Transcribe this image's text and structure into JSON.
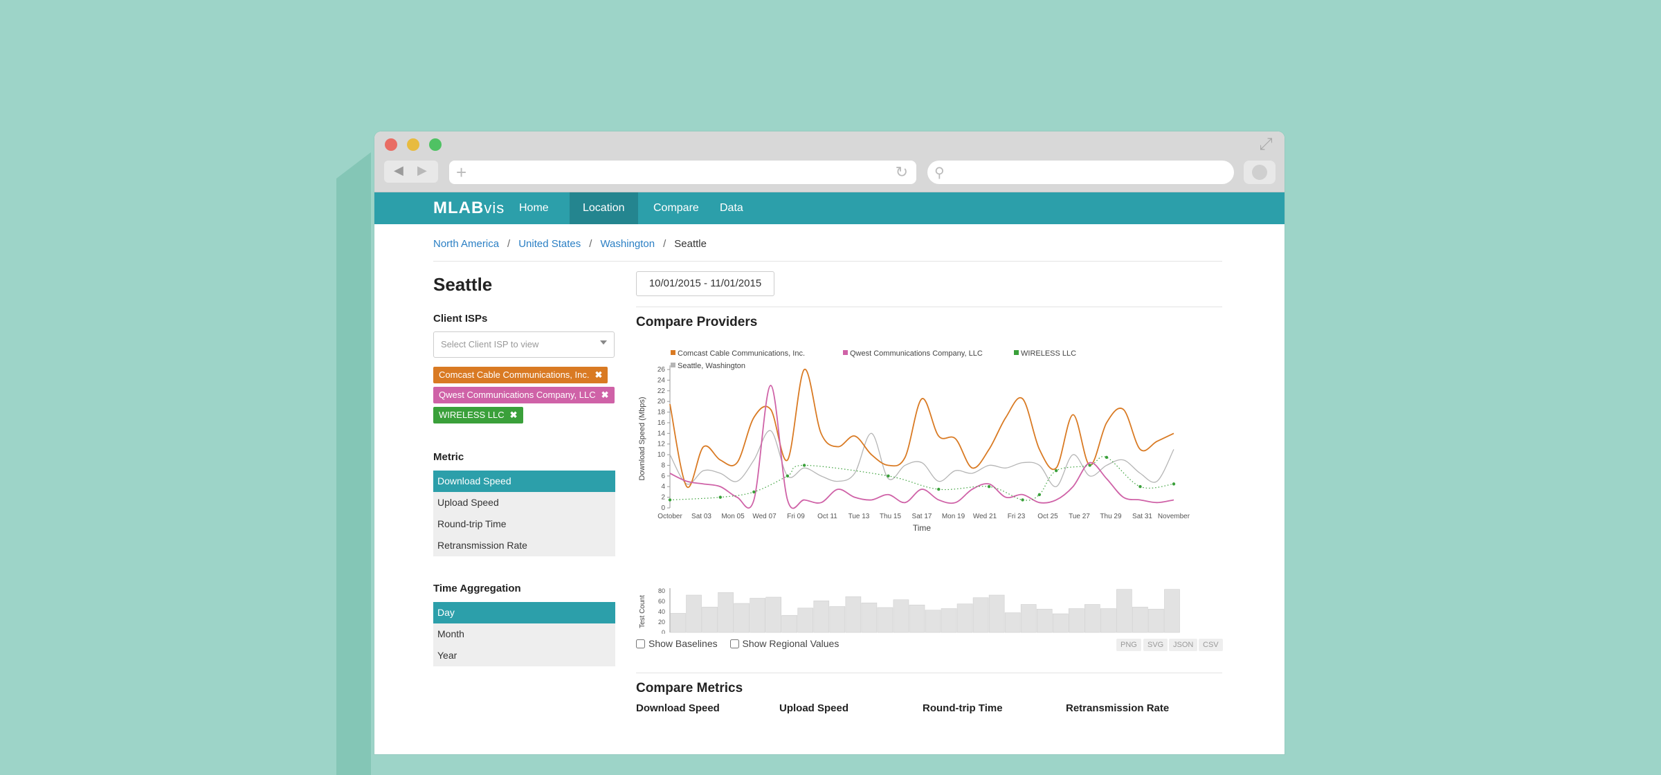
{
  "browser": {
    "url": "",
    "search": ""
  },
  "nav": {
    "logo_main": "MLAB",
    "logo_sub": "vis",
    "items": [
      {
        "label": "Home",
        "active": false
      },
      {
        "label": "Location",
        "active": true
      },
      {
        "label": "Compare",
        "active": false
      },
      {
        "label": "Data",
        "active": false
      }
    ]
  },
  "breadcrumb": [
    "North America",
    "United States",
    "Washington",
    "Seattle"
  ],
  "location": {
    "title": "Seattle",
    "isp_label": "Client ISPs",
    "isp_placeholder": "Select Client ISP to view",
    "isps": [
      {
        "label": "Comcast Cable Communications, Inc.",
        "color": "#d97a23"
      },
      {
        "label": "Qwest Communications Company, LLC",
        "color": "#cf62a7"
      },
      {
        "label": "WIRELESS LLC",
        "color": "#3aa03a"
      }
    ],
    "metric_label": "Metric",
    "metrics": [
      "Download Speed",
      "Upload Speed",
      "Round-trip Time",
      "Retransmission Rate"
    ],
    "metric_active": 0,
    "time_label": "Time Aggregation",
    "time_options": [
      "Day",
      "Month",
      "Year"
    ],
    "time_active": 0
  },
  "date_range": "10/01/2015 - 11/01/2015",
  "compare_title": "Compare Providers",
  "options": {
    "baselines": "Show Baselines",
    "regional": "Show Regional Values"
  },
  "export": [
    "PNG",
    "SVG",
    "JSON",
    "CSV"
  ],
  "metrics_section": {
    "title": "Compare Metrics",
    "columns": [
      "Download Speed",
      "Upload Speed",
      "Round-trip Time",
      "Retransmission Rate"
    ]
  },
  "chart_data": {
    "type": "line",
    "ylabel": "Download Speed (Mbps)",
    "xlabel": "Time",
    "ylim": [
      0,
      26
    ],
    "yticks": [
      0,
      2,
      4,
      6,
      8,
      10,
      12,
      14,
      16,
      18,
      20,
      22,
      24,
      26
    ],
    "xticks": [
      "October",
      "Sat 03",
      "Mon 05",
      "Wed 07",
      "Fri 09",
      "Oct 11",
      "Tue 13",
      "Thu 15",
      "Sat 17",
      "Mon 19",
      "Wed 21",
      "Fri 23",
      "Oct 25",
      "Tue 27",
      "Thu 29",
      "Sat 31",
      "November"
    ],
    "x": [
      1,
      2,
      3,
      4,
      5,
      6,
      7,
      8,
      9,
      10,
      11,
      12,
      13,
      14,
      15,
      16,
      17,
      18,
      19,
      20,
      21,
      22,
      23,
      24,
      25,
      26,
      27,
      28,
      29,
      30,
      31
    ],
    "series": [
      {
        "name": "Comcast Cable Communications, Inc.",
        "color": "#d97a23",
        "style": "solid",
        "values": [
          19.5,
          4,
          11.5,
          9,
          8.5,
          17,
          18.5,
          9,
          26,
          14,
          11.5,
          13.5,
          10,
          8,
          9.5,
          20.5,
          13.5,
          13,
          7.5,
          11,
          17,
          20.5,
          11,
          7.5,
          17.5,
          8,
          16,
          18.5,
          11,
          12.5,
          14
        ]
      },
      {
        "name": "Qwest Communications Company, LLC",
        "color": "#cf62a7",
        "style": "solid",
        "values": [
          6.5,
          5,
          4.5,
          4,
          2,
          1.5,
          23,
          1.5,
          1.5,
          1,
          3.5,
          2,
          1.5,
          2.5,
          1,
          3.5,
          1.5,
          1,
          3.5,
          4.5,
          2,
          2.5,
          1,
          1.5,
          4,
          8.5,
          5.5,
          2,
          1.5,
          1,
          1.5
        ]
      },
      {
        "name": "WIRELESS LLC",
        "color": "#3aa03a",
        "style": "dotted",
        "values": [
          1.5,
          null,
          null,
          2,
          null,
          3,
          null,
          6,
          8,
          null,
          null,
          null,
          null,
          6,
          null,
          null,
          3.5,
          null,
          null,
          4,
          null,
          1.5,
          2.5,
          7,
          null,
          8,
          9.5,
          null,
          4,
          null,
          4.5
        ]
      },
      {
        "name": "Seattle, Washington",
        "color": "#b5b5b5",
        "style": "solid",
        "values": [
          10,
          4.5,
          7,
          6.5,
          5,
          9,
          14.5,
          6,
          7.5,
          6,
          5,
          6.5,
          14,
          5.5,
          8,
          8.5,
          5,
          7,
          6.5,
          8,
          7.5,
          8.5,
          8,
          4,
          10,
          6,
          8,
          9,
          6.5,
          5,
          11
        ]
      }
    ],
    "test_count": {
      "label": "Test Count",
      "ylim": [
        0,
        80
      ],
      "yticks": [
        0,
        20,
        40,
        60,
        80
      ],
      "values": [
        37,
        72,
        49,
        77,
        56,
        66,
        68,
        33,
        47,
        61,
        50,
        69,
        57,
        48,
        63,
        53,
        43,
        46,
        55,
        67,
        72,
        38,
        54,
        45,
        36,
        46,
        54,
        46,
        83,
        49,
        45,
        83
      ]
    }
  }
}
